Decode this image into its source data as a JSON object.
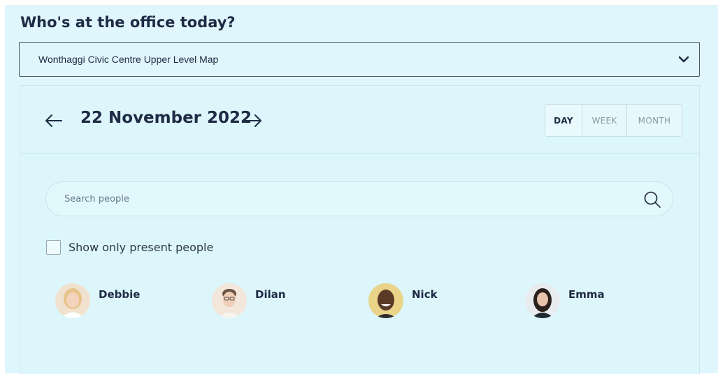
{
  "page": {
    "title": "Who's at the office today?"
  },
  "location_select": {
    "value": "Wonthaggi Civic Centre Upper Level Map",
    "icon": "chevron-down-icon"
  },
  "date_nav": {
    "prev_icon": "arrow-left-icon",
    "next_icon": "arrow-right-icon",
    "date": "22 November 2022"
  },
  "view_toggle": {
    "options": [
      "DAY",
      "WEEK",
      "MONTH"
    ],
    "selected": "DAY"
  },
  "search": {
    "placeholder": "Search people",
    "value": "",
    "icon": "search-icon"
  },
  "filter": {
    "label": "Show only present people",
    "checked": false
  },
  "people": [
    {
      "name": "Debbie"
    },
    {
      "name": "Dilan"
    },
    {
      "name": "Nick"
    },
    {
      "name": "Emma"
    }
  ],
  "colors": {
    "background": "#dff7fc",
    "text": "#1f2b45",
    "muted": "#8a98a8",
    "border": "#4a5568"
  }
}
